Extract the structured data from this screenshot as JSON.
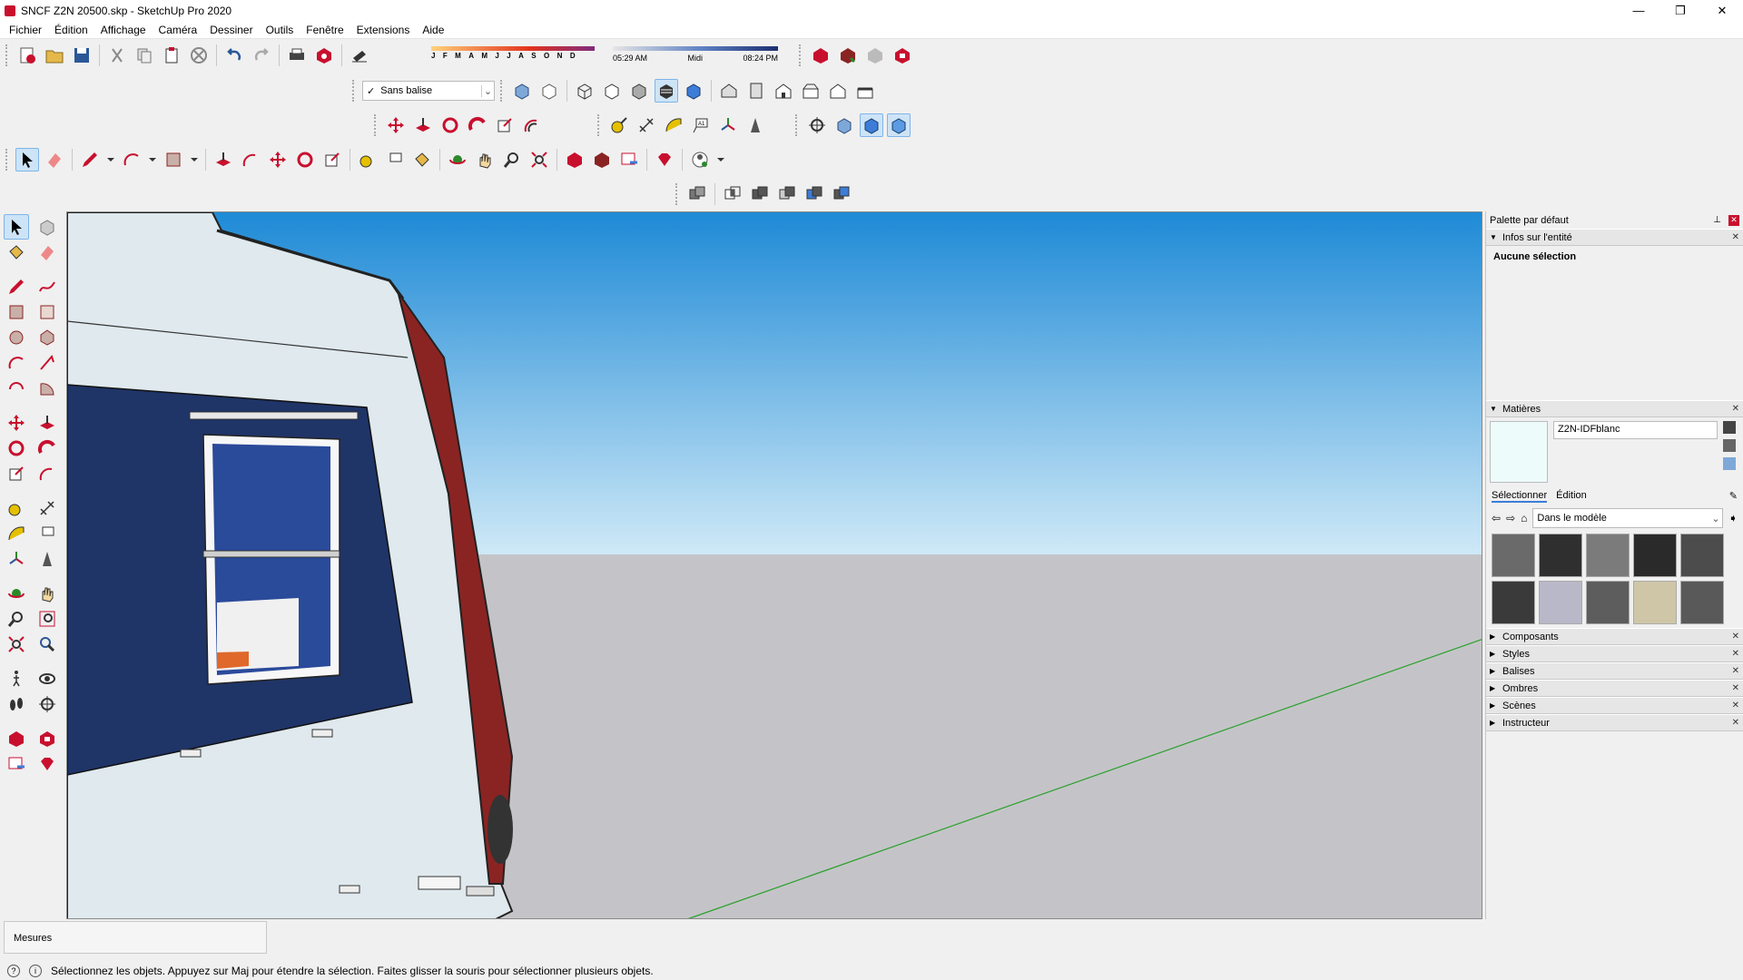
{
  "window": {
    "title": "SNCF Z2N 20500.skp - SketchUp Pro 2020",
    "minimize": "—",
    "maximize": "❐",
    "close": "✕"
  },
  "menu": [
    "Fichier",
    "Édition",
    "Affichage",
    "Caméra",
    "Dessiner",
    "Outils",
    "Fenêtre",
    "Extensions",
    "Aide"
  ],
  "tag_dropdown": {
    "check": "✓",
    "value": "Sans balise"
  },
  "shadow_months": [
    "J",
    "F",
    "M",
    "A",
    "M",
    "J",
    "J",
    "A",
    "S",
    "O",
    "N",
    "D"
  ],
  "shadow_time": {
    "start": "05:29 AM",
    "mid": "Midi",
    "end": "08:24 PM"
  },
  "panel": {
    "title": "Palette par défaut",
    "entity": {
      "header": "Infos sur l'entité",
      "body": "Aucune sélection"
    },
    "materials": {
      "header": "Matières",
      "current_name": "Z2N-IDFblanc",
      "tab_select": "Sélectionner",
      "tab_edit": "Édition",
      "collection": "Dans le modèle",
      "swatches": [
        "#6a6a6a",
        "#2f2f2f",
        "#7b7b7b",
        "#2a2a2a",
        "#4c4c4c",
        "#3a3a3a",
        "#b8b8c8",
        "#5d5d5d",
        "#cfc6a8",
        "#595959"
      ],
      "preview_color": "#eefbfb"
    },
    "collapsed": [
      "Composants",
      "Styles",
      "Balises",
      "Ombres",
      "Scènes",
      "Instructeur"
    ]
  },
  "status": {
    "measures_label": "Mesures",
    "hint": "Sélectionnez les objets. Appuyez sur Maj pour étendre la sélection. Faites glisser la souris pour sélectionner plusieurs objets."
  },
  "colors": {
    "accent": "#3d7dd8",
    "sky_top": "#1e8ad6",
    "sky_bottom": "#cfe9f7",
    "ground": "#c4c4c8",
    "train_blue": "#1f3467",
    "train_red": "#8a2423",
    "train_body": "#dfe9ee"
  }
}
